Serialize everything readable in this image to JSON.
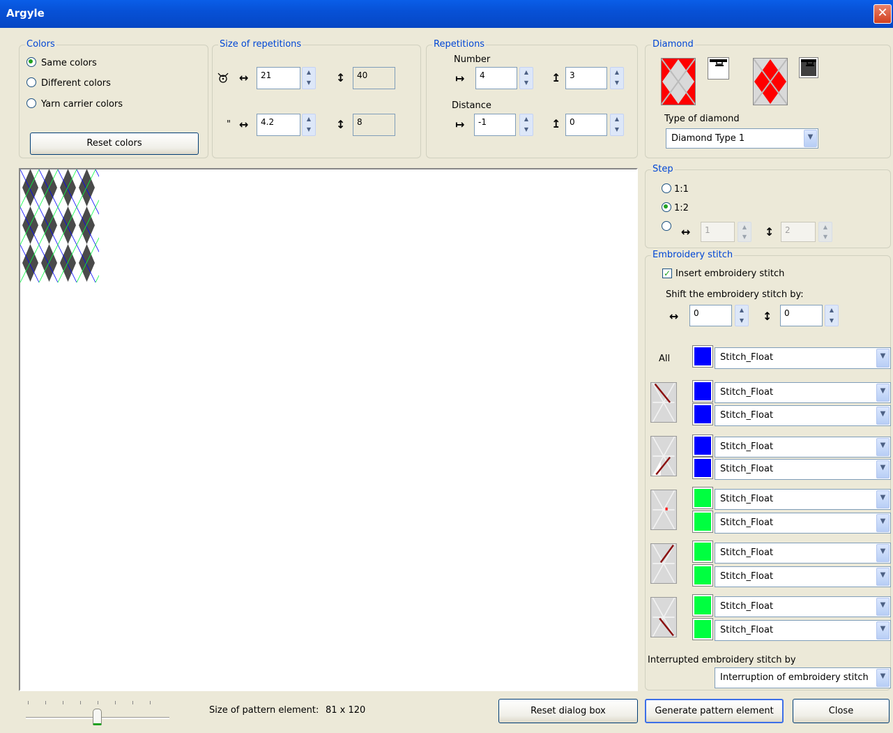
{
  "window": {
    "title": "Argyle",
    "close_glyph": "✕"
  },
  "colors_group": {
    "title": "Colors",
    "options": [
      "Same colors",
      "Different colors",
      "Yarn carrier colors"
    ],
    "selected": 0,
    "reset_button": "Reset colors"
  },
  "size_group": {
    "title": "Size of repetitions",
    "row1": {
      "h_value": "21",
      "v_value": "40"
    },
    "row2": {
      "unit_label": "\"",
      "h_value": "4.2",
      "v_value": "8"
    }
  },
  "repetitions_group": {
    "title": "Repetitions",
    "number_label": "Number",
    "number": {
      "h_value": "4",
      "v_value": "3"
    },
    "distance_label": "Distance",
    "distance": {
      "h_value": "-1",
      "v_value": "0"
    }
  },
  "diamond_group": {
    "title": "Diamond",
    "type_label": "Type of diamond",
    "type_value": "Diamond Type 1",
    "colors": {
      "primary": "#ff0000",
      "swatch_dark": "#404040"
    }
  },
  "step_group": {
    "title": "Step",
    "options": [
      "1:1",
      "1:2"
    ],
    "selected": 1,
    "custom_h": "1",
    "custom_v": "2"
  },
  "embroidery_group": {
    "title": "Embroidery stitch",
    "insert_label": "Insert embroidery stitch",
    "insert_checked": true,
    "shift_label": "Shift the embroidery stitch by:",
    "shift_h": "0",
    "shift_v": "0",
    "all_label": "All",
    "all_color": "#0000ff",
    "all_value": "Stitch_Float",
    "rows": [
      {
        "color": "#0000ff",
        "value": "Stitch_Float"
      },
      {
        "color": "#0000ff",
        "value": "Stitch_Float"
      },
      {
        "color": "#0000ff",
        "value": "Stitch_Float"
      },
      {
        "color": "#0000ff",
        "value": "Stitch_Float"
      },
      {
        "color": "#00ff40",
        "value": "Stitch_Float"
      },
      {
        "color": "#00ff40",
        "value": "Stitch_Float"
      },
      {
        "color": "#00ff40",
        "value": "Stitch_Float"
      },
      {
        "color": "#00ff40",
        "value": "Stitch_Float"
      },
      {
        "color": "#00ff40",
        "value": "Stitch_Float"
      },
      {
        "color": "#00ff40",
        "value": "Stitch_Float"
      }
    ],
    "interrupted_label": "Interrupted embroidery stitch by",
    "interrupted_value": "Interruption of embroidery stitch"
  },
  "footer": {
    "size_label": "Size of pattern element:",
    "size_value": "81 x 120",
    "reset_dialog": "Reset dialog box",
    "generate": "Generate pattern element",
    "close": "Close"
  },
  "pattern_preview": {
    "diamond_color": "#4a4a4a",
    "line_color_1": "#0000ff",
    "line_color_2": "#00ff40",
    "cols": 4,
    "rows": 3
  }
}
